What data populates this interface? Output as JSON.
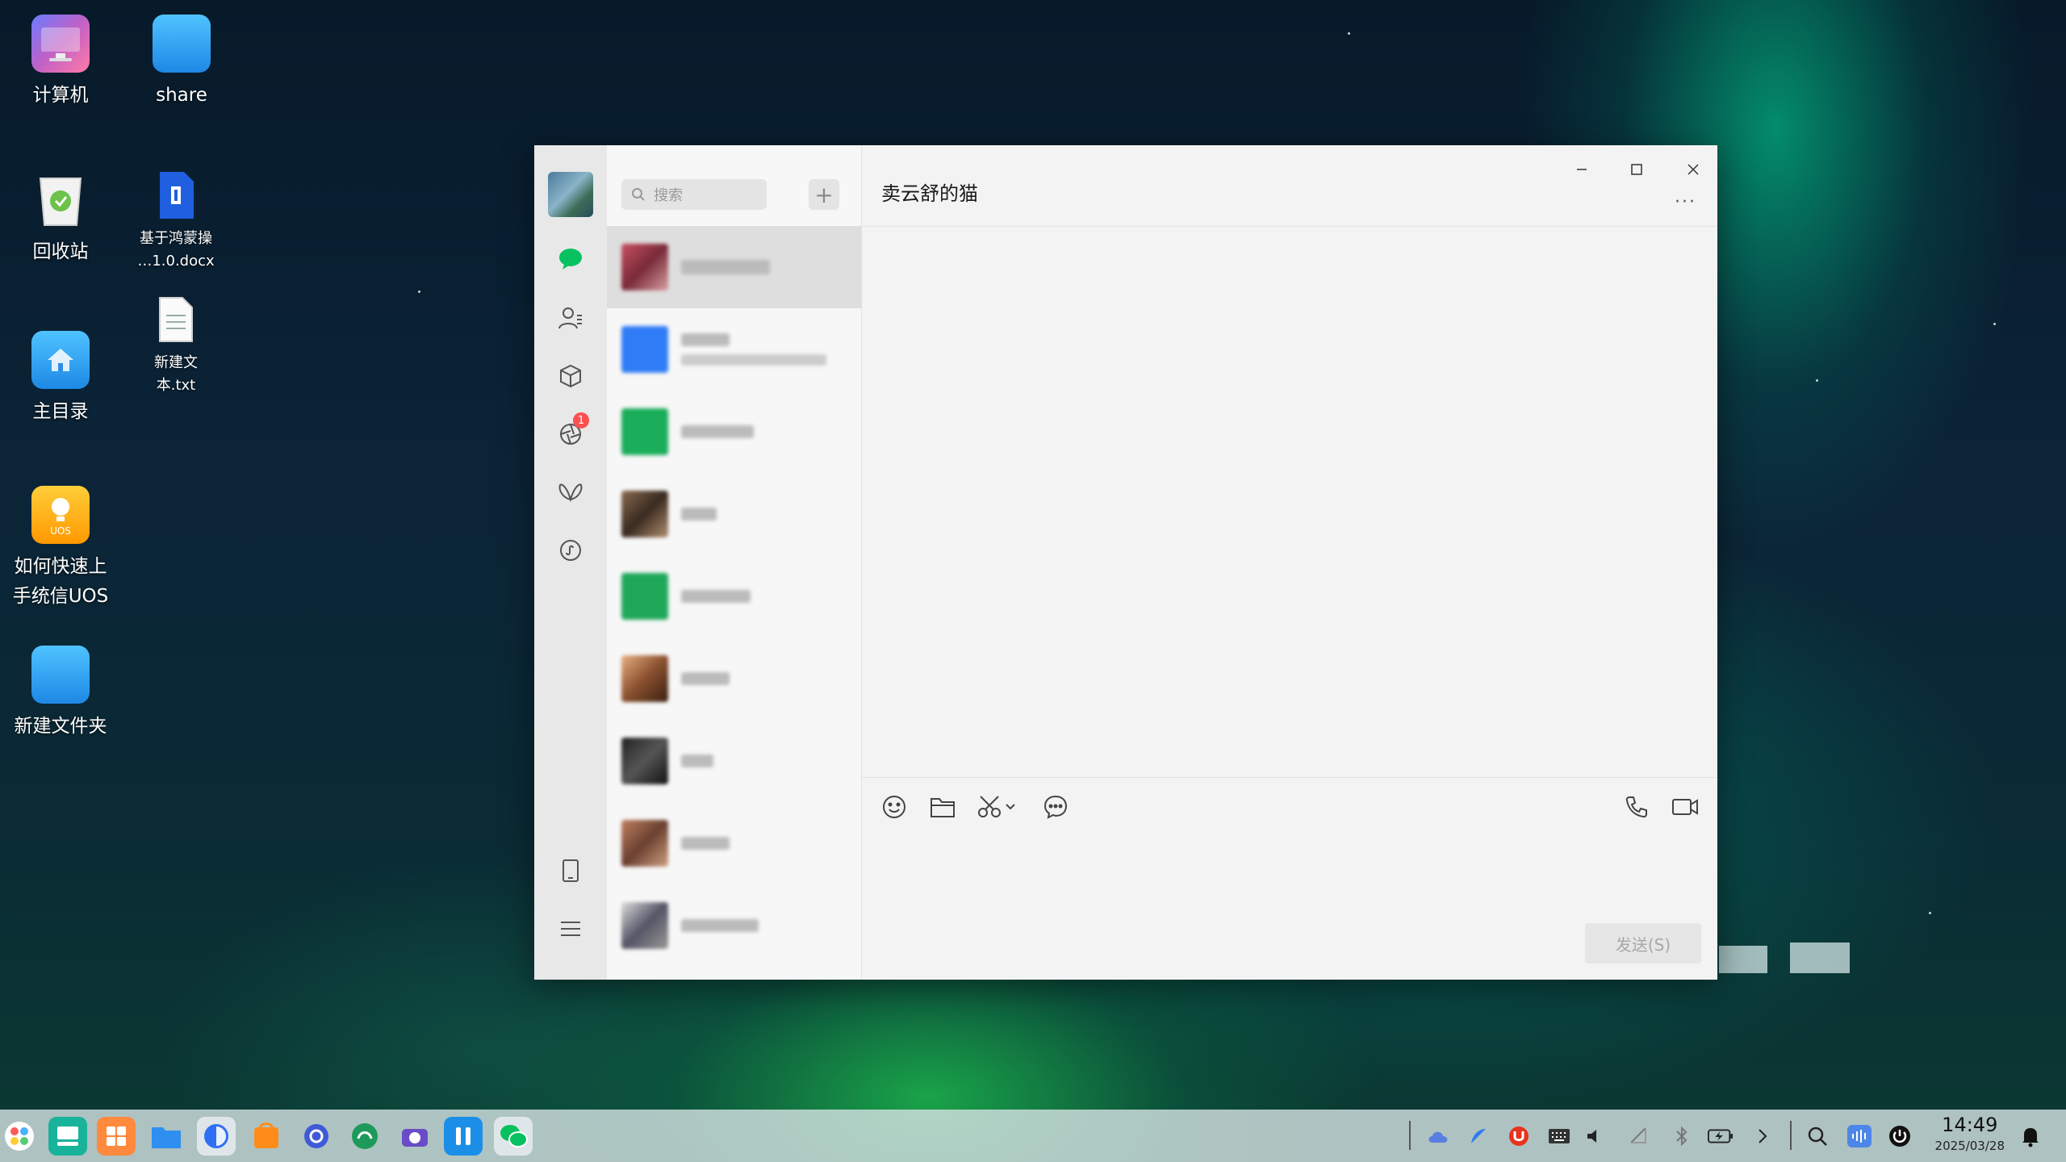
{
  "desktop": {
    "icons": [
      {
        "label": "计算机"
      },
      {
        "label": "share"
      },
      {
        "label": "回收站"
      },
      {
        "label": "基于鸿蒙操\n…1.0.docx"
      },
      {
        "label": "新建文\n本.txt"
      },
      {
        "label": "主目录"
      },
      {
        "label": "如何快速上\n手统信UOS"
      },
      {
        "label": "新建文件夹"
      }
    ]
  },
  "wechat": {
    "search_placeholder": "搜索",
    "add_label": "+",
    "chat_title": "卖云舒的猫",
    "more_label": "···",
    "send_label": "发送(S)",
    "moments_badge": "1"
  },
  "taskbar": {
    "time": "14:49",
    "date": "2025/03/28"
  }
}
